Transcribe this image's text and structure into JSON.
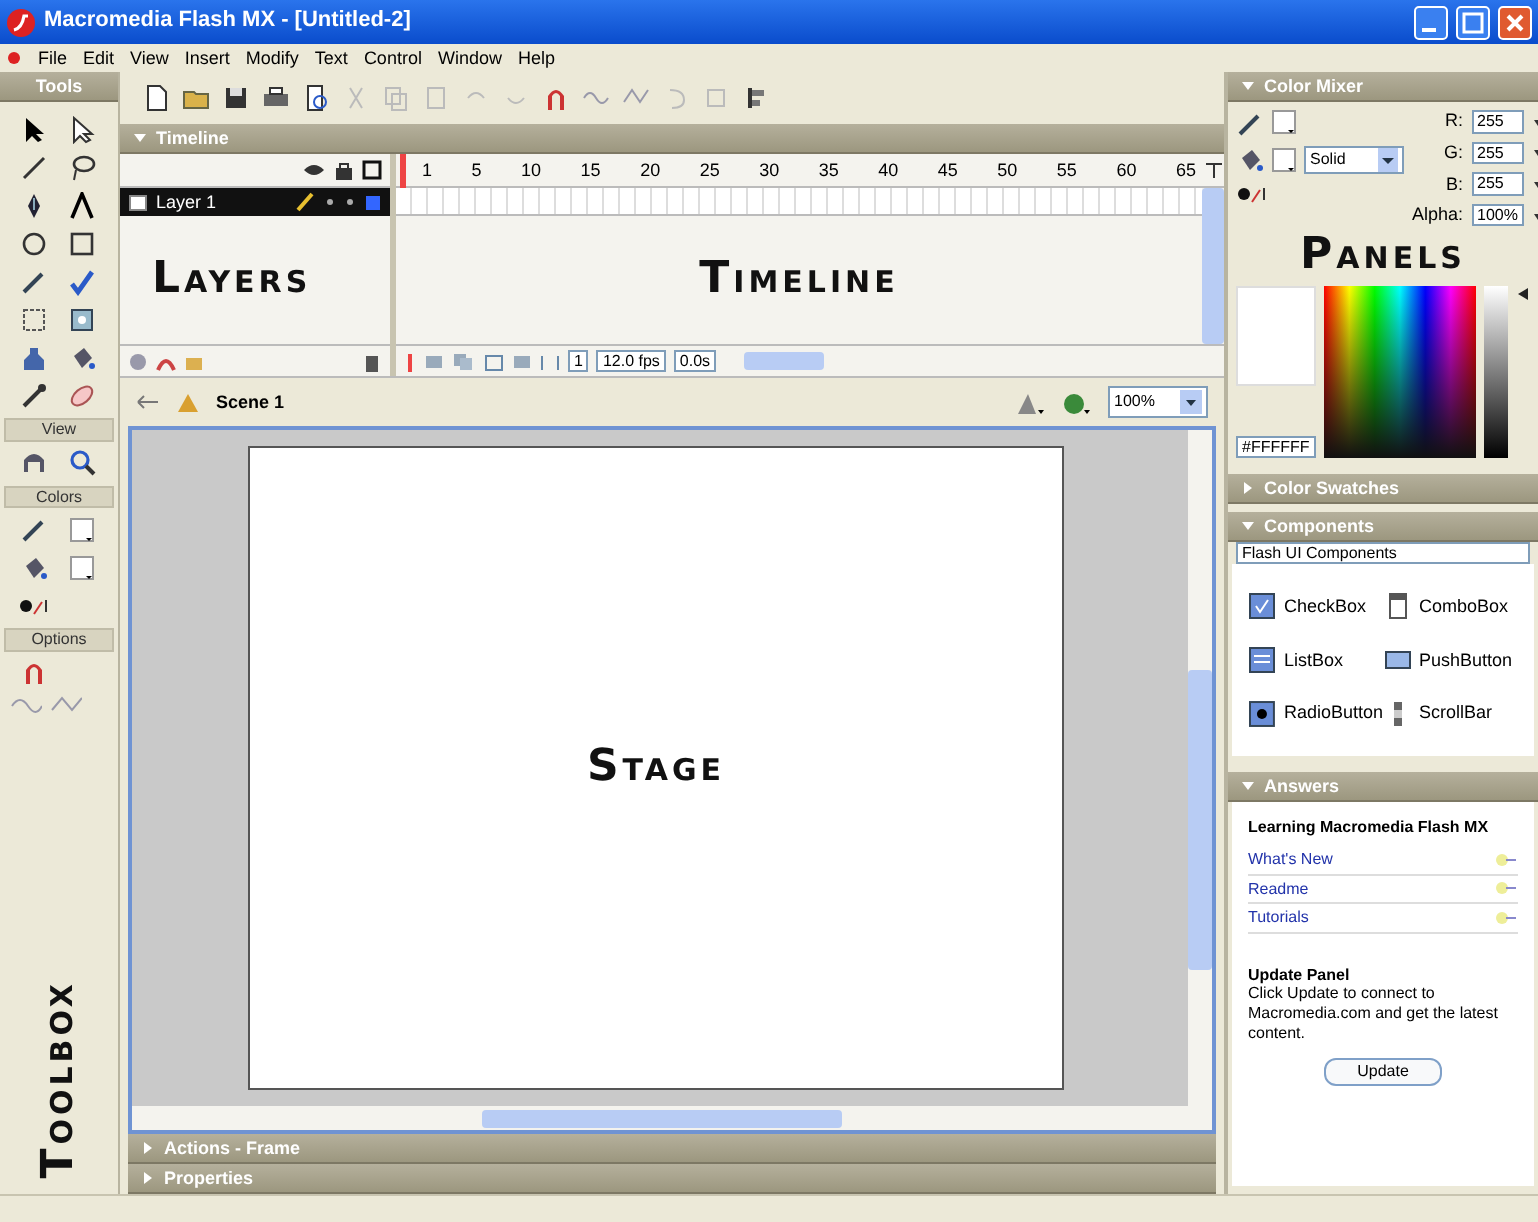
{
  "window": {
    "title": "Macromedia Flash MX - [Untitled-2]"
  },
  "menu": [
    "File",
    "Edit",
    "View",
    "Insert",
    "Modify",
    "Text",
    "Control",
    "Window",
    "Help"
  ],
  "tools": {
    "title": "Tools",
    "sections": [
      "View",
      "Colors",
      "Options"
    ],
    "annotation": "Toolbox"
  },
  "timeline": {
    "title": "Timeline",
    "expanded": true,
    "annotation": "Timeline",
    "layers_annotation": "Layers",
    "frame_numbers": [
      "1",
      "5",
      "10",
      "15",
      "20",
      "25",
      "30",
      "35",
      "40",
      "45",
      "50",
      "55",
      "60",
      "65"
    ],
    "layers": [
      {
        "name": "Layer 1",
        "selected": true
      }
    ],
    "current_frame": "1",
    "frame_rate": "12.0 fps",
    "elapsed_time": "0.0s"
  },
  "scene": {
    "name": "Scene 1",
    "zoom": "100%"
  },
  "stage": {
    "annotation": "Stage"
  },
  "bottom_panels": [
    {
      "title": "Actions - Frame",
      "expanded": false
    },
    {
      "title": "Properties",
      "expanded": false
    }
  ],
  "color_mixer": {
    "title": "Color Mixer",
    "expanded": true,
    "fill_style": "Solid",
    "channels": [
      {
        "label": "R:",
        "value": "255"
      },
      {
        "label": "G:",
        "value": "255"
      },
      {
        "label": "B:",
        "value": "255"
      },
      {
        "label": "Alpha:",
        "value": "100%"
      }
    ],
    "hex": "#FFFFFF",
    "annotation": "Panels"
  },
  "color_swatches": {
    "title": "Color Swatches",
    "expanded": false
  },
  "components": {
    "title": "Components",
    "expanded": true,
    "set": "Flash UI Components",
    "items": [
      {
        "name": "CheckBox",
        "kind": "checkbox"
      },
      {
        "name": "ComboBox",
        "kind": "combobox"
      },
      {
        "name": "ListBox",
        "kind": "listbox"
      },
      {
        "name": "PushButton",
        "kind": "pushbutton"
      },
      {
        "name": "RadioButton",
        "kind": "radiobutton"
      },
      {
        "name": "ScrollBar",
        "kind": "scrollbar"
      }
    ]
  },
  "answers": {
    "title": "Answers",
    "expanded": true,
    "heading": "Learning Macromedia Flash MX",
    "links": [
      "What's New",
      "Readme",
      "Tutorials"
    ],
    "update_title": "Update Panel",
    "update_text": "Click Update to connect to Macromedia.com and get the latest content.",
    "button": "Update"
  }
}
